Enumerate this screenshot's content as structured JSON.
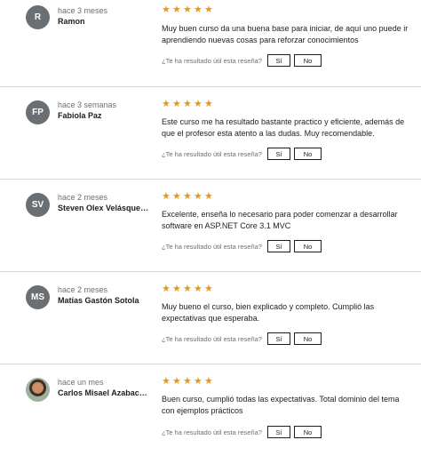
{
  "helpful_question": "¿Te ha resultado útil esta reseña?",
  "yes_label": "Sí",
  "no_label": "No",
  "star_color": "#e59819",
  "reviews": [
    {
      "initials": "R",
      "time": "hace 3 meses",
      "name": "Ramon",
      "rating": 5,
      "text": "Muy buen curso da una buena base para iniciar, de aquí uno puede ir aprendiendo nuevas cosas para reforzar conocimientos"
    },
    {
      "initials": "FP",
      "time": "hace 3 semanas",
      "name": "Fabiola Paz",
      "rating": 5,
      "text": "Este curso me ha resultado bastante practico y eficiente, además de que el profesor esta atento a las dudas. Muy recomendable."
    },
    {
      "initials": "SV",
      "time": "hace 2 meses",
      "name": "Steven Olex Velásquez Ji...",
      "rating": 5,
      "text": "Excelente, enseña lo necesario para poder comenzar a desarrollar software en ASP.NET Core 3.1 MVC"
    },
    {
      "initials": "MS",
      "time": "hace 2 meses",
      "name": "Matías Gastón Sotola",
      "rating": 5,
      "text": "Muy bueno el curso, bien explicado y completo. Cumplió las expectativas que esperaba."
    },
    {
      "initials": "",
      "time": "hace un mes",
      "name": "Carlos Misael Azabache S...",
      "rating": 5,
      "text": "Buen curso, cumplió todas las expectativas. Total dominio del tema con ejemplos prácticos"
    }
  ]
}
